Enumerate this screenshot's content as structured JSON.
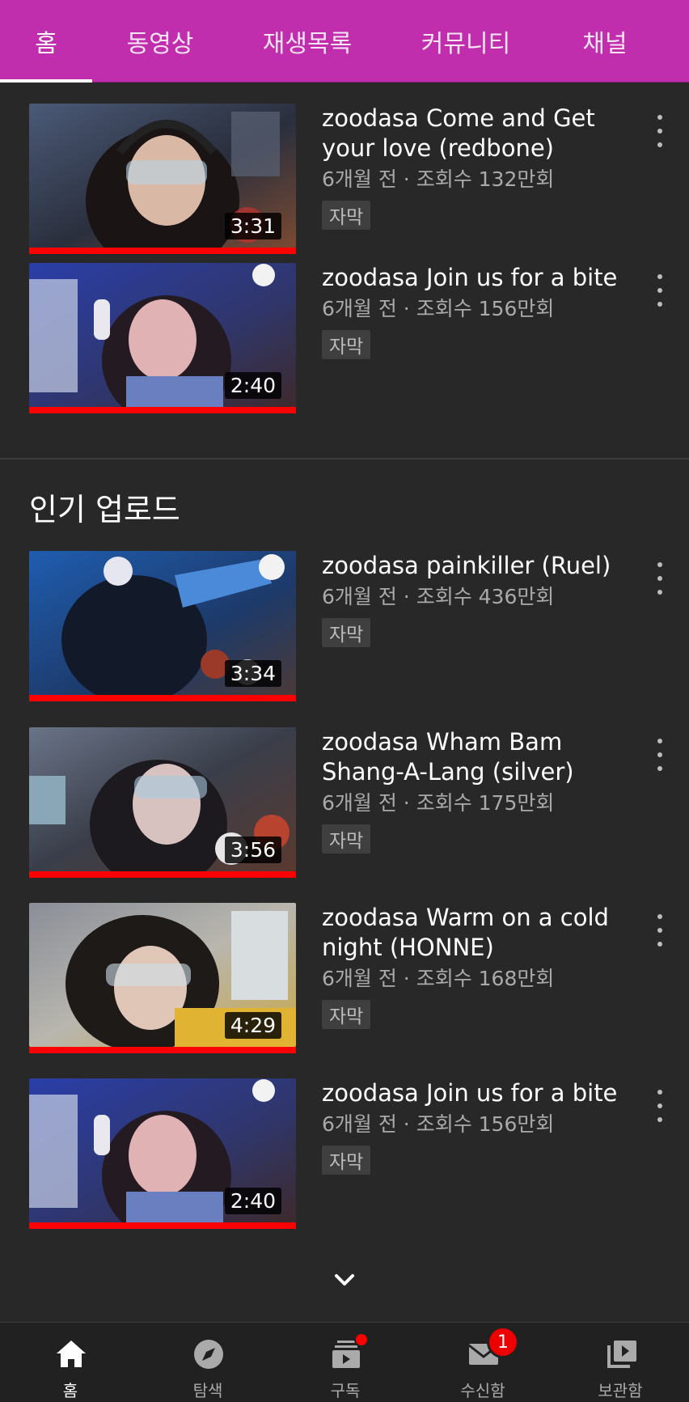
{
  "tabs": [
    {
      "label": "홈",
      "active": true
    },
    {
      "label": "동영상",
      "active": false
    },
    {
      "label": "재생목록",
      "active": false
    },
    {
      "label": "커뮤니티",
      "active": false
    },
    {
      "label": "채널",
      "active": false
    }
  ],
  "videos_top": [
    {
      "title": "zoodasa Come and Get your love (redbone)",
      "sub": "6개월 전 · 조회수 132만회",
      "badge": "자막",
      "duration": "3:31",
      "watched": 1.0
    },
    {
      "title": "zoodasa Join us for a bite",
      "sub": "6개월 전 · 조회수 156만회",
      "badge": "자막",
      "duration": "2:40",
      "watched": 1.0
    }
  ],
  "popular": {
    "title": "인기 업로드",
    "videos": [
      {
        "title": "zoodasa painkiller (Ruel)",
        "sub": "6개월 전 · 조회수 436만회",
        "badge": "자막",
        "duration": "3:34",
        "watched": 1.0
      },
      {
        "title": "zoodasa Wham Bam Shang-A-Lang (silver)",
        "sub": "6개월 전 · 조회수 175만회",
        "badge": "자막",
        "duration": "3:56",
        "watched": 1.0
      },
      {
        "title": "zoodasa Warm on a cold night (HONNE)",
        "sub": "6개월 전 · 조회수 168만회",
        "badge": "자막",
        "duration": "4:29",
        "watched": 1.0
      },
      {
        "title": "zoodasa Join us for a bite",
        "sub": "6개월 전 · 조회수 156만회",
        "badge": "자막",
        "duration": "2:40",
        "watched": 1.0
      }
    ]
  },
  "bottom_nav": [
    {
      "label": "홈",
      "icon": "home-icon",
      "active": true
    },
    {
      "label": "탐색",
      "icon": "compass-icon",
      "active": false
    },
    {
      "label": "구독",
      "icon": "subscriptions-icon",
      "active": false,
      "dot": true
    },
    {
      "label": "수신함",
      "icon": "inbox-icon",
      "active": false,
      "count": "1"
    },
    {
      "label": "보관함",
      "icon": "library-icon",
      "active": false
    }
  ],
  "colors": {
    "header": "#c02eae",
    "background": "#282828",
    "progress": "#ff0000",
    "nav_bg": "#212121"
  }
}
